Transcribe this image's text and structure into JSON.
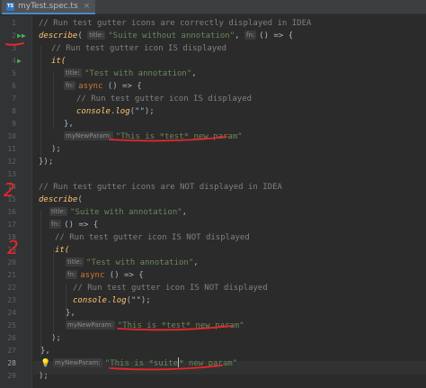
{
  "tab": {
    "icon": "typescript-file-icon",
    "title": "myTest.spec.ts",
    "close_icon": "close-icon"
  },
  "gutter": {
    "numbers": [
      "1",
      "2",
      "3",
      "4",
      "5",
      "6",
      "7",
      "8",
      "9",
      "10",
      "11",
      "12",
      "13",
      "14",
      "15",
      "16",
      "17",
      "18",
      "19",
      "20",
      "21",
      "22",
      "23",
      "24",
      "25",
      "26",
      "27",
      "28",
      "29"
    ],
    "current_line": "28",
    "run_icons": [
      {
        "line": "2",
        "glyph": "▶▶",
        "icon": "run-suite-icon"
      },
      {
        "line": "4",
        "glyph": "▶",
        "icon": "run-test-icon"
      }
    ]
  },
  "hints": {
    "title": "title:",
    "fn": "fn:",
    "myNewParam": "myNewParam:"
  },
  "code": {
    "l1": "// Run test gutter icons are correctly displayed in IDEA",
    "l2_describe": "describe",
    "l2_paren": "(",
    "l2_str": "\"Suite without annotation\"",
    "l2_comma": ", ",
    "l2_rest": "() => {",
    "l3": "// Run test gutter icon IS displayed",
    "l4": "it(",
    "l5_str": "\"Test with annotation\"",
    "l5_rest": ",",
    "l6_kw": "async",
    "l6_rest": " () => {",
    "l7": "// Run test gutter icon IS displayed",
    "l8_obj": "console",
    "l8_dot": ".",
    "l8_fn": "log",
    "l8_rest": "(\"\");",
    "l9": "},",
    "l10_str": "\"This is *test* new param\"",
    "l11": ");",
    "l12": "});",
    "l14": "// Run test gutter icons are NOT displayed in IDEA",
    "l15_describe": "describe",
    "l15_rest": "(",
    "l16_str": "\"Suite with annotation\"",
    "l16_rest": ",",
    "l17_rest": "() => {",
    "l18": "// Run test gutter icon IS NOT displayed",
    "l19": "it(",
    "l20_str": "\"Test with annotation\"",
    "l20_rest": ",",
    "l21_kw": "async",
    "l21_rest": " () => {",
    "l22": "// Run test gutter icon IS NOT displayed",
    "l23_obj": "console",
    "l23_dot": ".",
    "l23_fn": "log",
    "l23_rest": "(\"\");",
    "l24": "},",
    "l25_str": "\"This is *test* new param\"",
    "l26": ");",
    "l27": "},",
    "l28_str_a": "\"This is *suite",
    "l28_str_b": "* new param\"",
    "l29": ");"
  },
  "annotations": {
    "ink_color": "#e8262a",
    "marks": [
      "2",
      "2"
    ],
    "bulb_icon": "lightbulb-icon"
  }
}
